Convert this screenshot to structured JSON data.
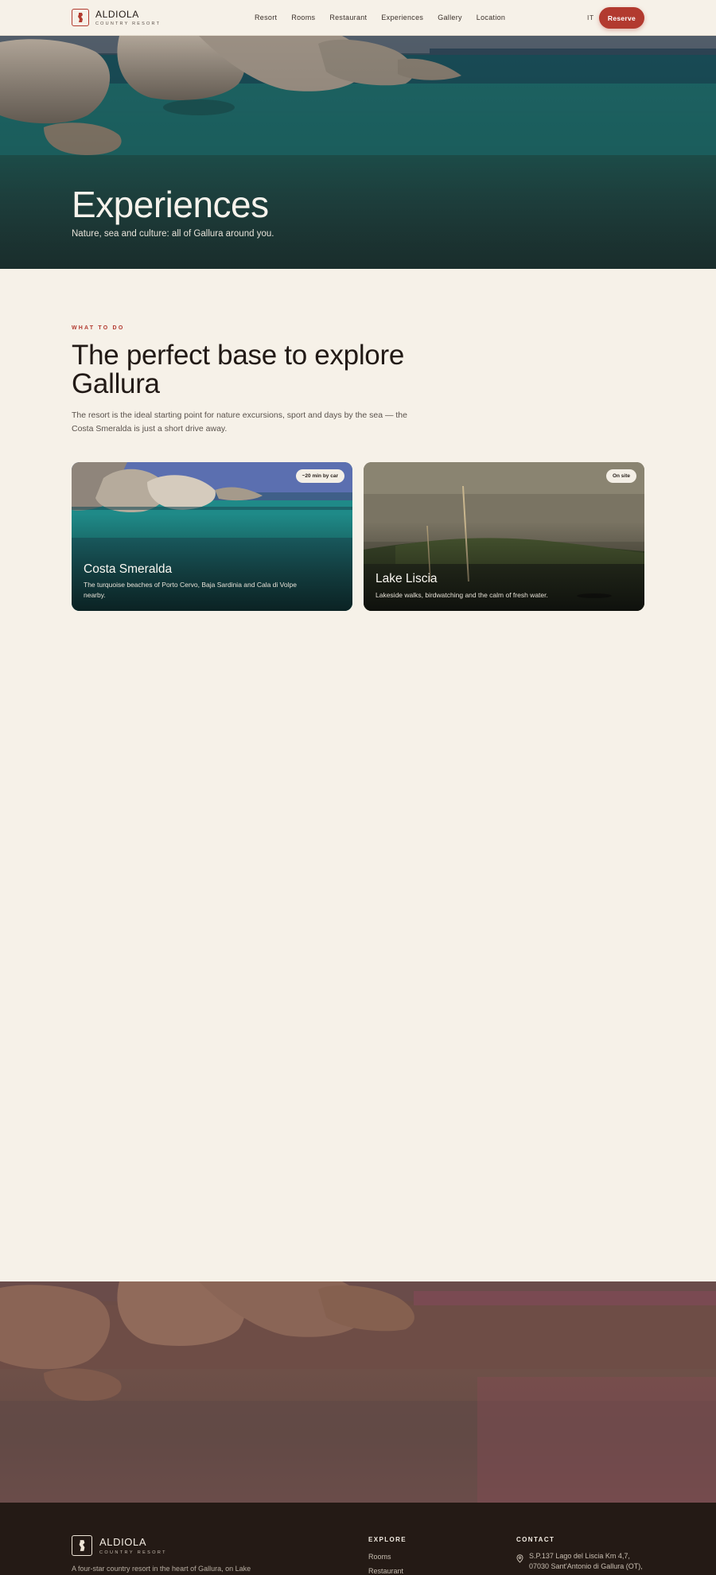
{
  "header": {
    "brand_name": "ALDIOLA",
    "brand_sub": "COUNTRY RESORT",
    "nav": [
      "Resort",
      "Rooms",
      "Restaurant",
      "Experiences",
      "Gallery",
      "Location"
    ],
    "lang": "IT",
    "reserve_label": "Reserve",
    "accent_color": "#b23a2f"
  },
  "hero": {
    "title": "Experiences",
    "subtitle": "Nature, sea and culture: all of Gallura around you."
  },
  "intro": {
    "eyebrow": "WHAT TO DO",
    "title": "The perfect base to explore Gallura",
    "description": "The resort is the ideal starting point for nature excursions, sport and days by the sea — the Costa Smeralda is just a short drive away."
  },
  "cards": [
    {
      "badge": "~20 min by car",
      "title": "Costa Smeralda",
      "description": "The turquoise beaches of Porto Cervo, Baja Sardinia and Cala di Volpe nearby."
    },
    {
      "badge": "On site",
      "title": "Lake Liscia",
      "description": "Lakeside walks, birdwatching and the calm of fresh water."
    }
  ],
  "footer": {
    "brand_name": "ALDIOLA",
    "brand_sub": "COUNTRY RESORT",
    "about": "A four-star country resort in the heart of Gallura, on Lake",
    "explore_heading": "EXPLORE",
    "explore_links": [
      "Rooms",
      "Restaurant"
    ],
    "contact_heading": "CONTACT",
    "address": "S.P.137 Lago del Liscia Km 4,7, 07030 Sant'Antonio di Gallura (OT),"
  }
}
